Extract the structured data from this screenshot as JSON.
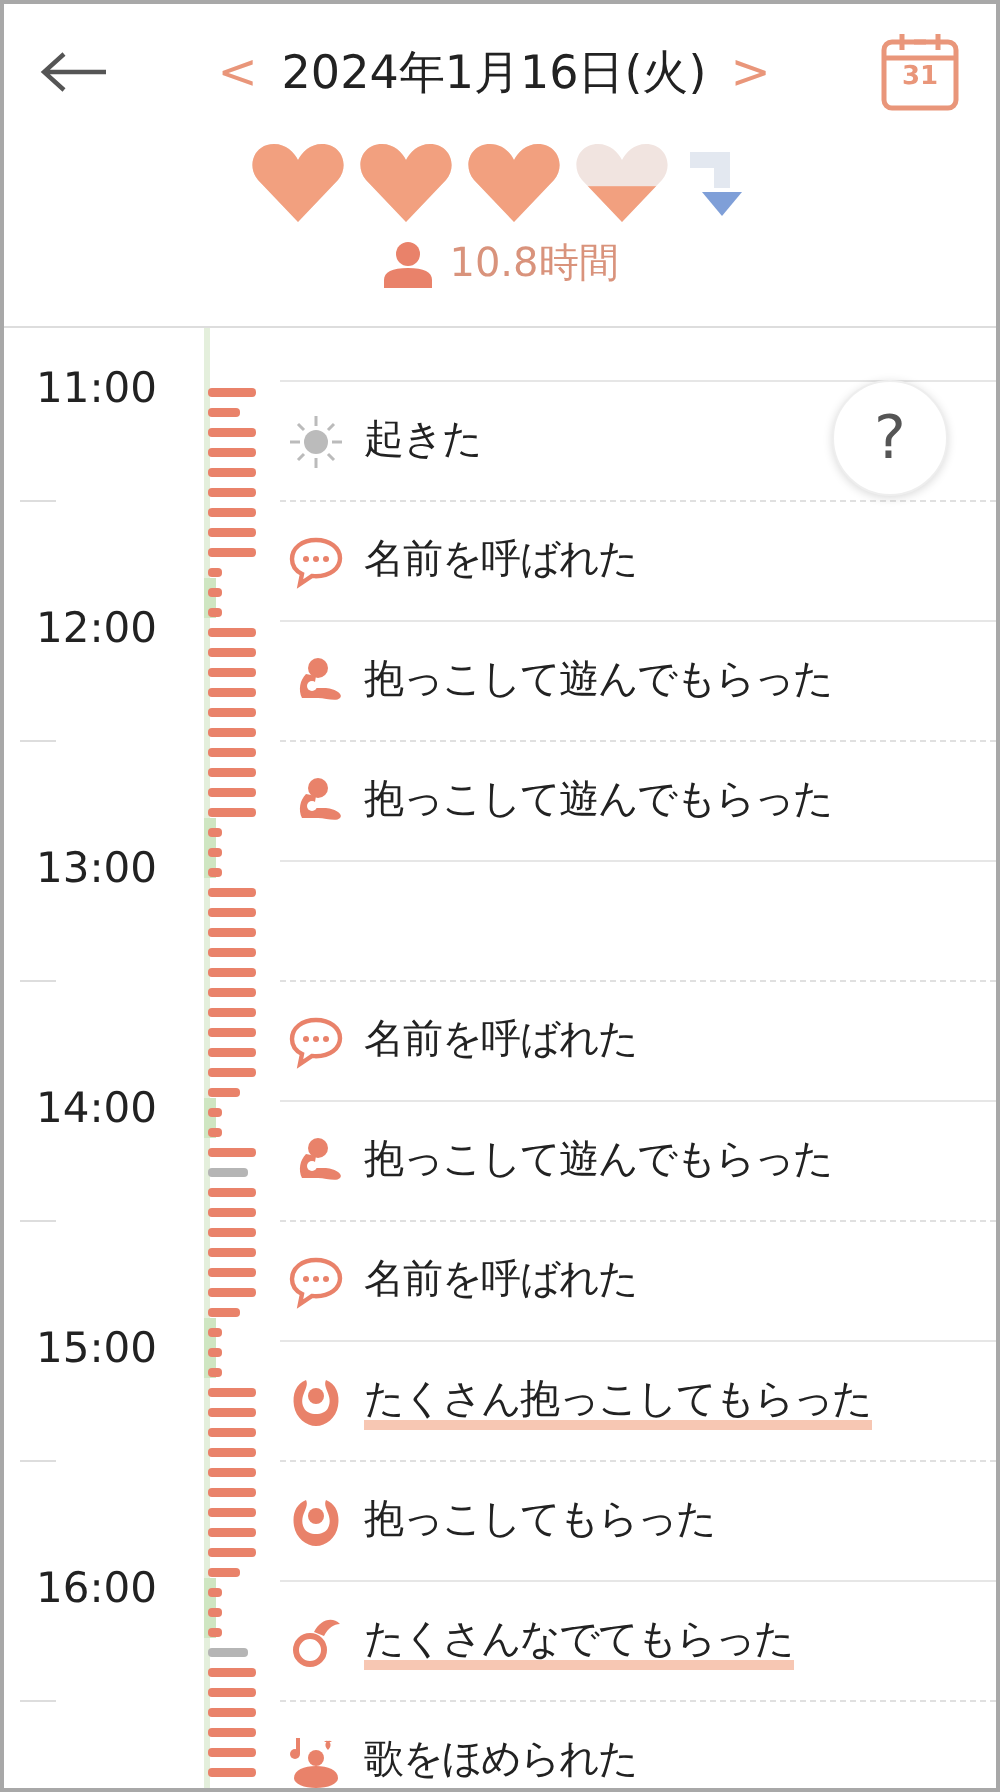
{
  "header": {
    "date": "2024年1月16日(火)",
    "prev_label": "<",
    "next_label": ">",
    "calendar_day": "31"
  },
  "hearts": [
    {
      "kind": "full"
    },
    {
      "kind": "full"
    },
    {
      "kind": "full"
    },
    {
      "kind": "half"
    }
  ],
  "summary": {
    "duration": "10.8時間"
  },
  "hours": [
    "11:00",
    "12:00",
    "13:00",
    "14:00",
    "15:00",
    "16:00"
  ],
  "help_label": "?",
  "events": [
    {
      "kind": "wake",
      "label": "起きた",
      "emphasis": false
    },
    {
      "kind": "called",
      "label": "名前を呼ばれた",
      "emphasis": false
    },
    {
      "kind": "hold_play",
      "label": "抱っこして遊んでもらった",
      "emphasis": false
    },
    {
      "kind": "hold_play",
      "label": "抱っこして遊んでもらった",
      "emphasis": false
    },
    {
      "kind": "gap"
    },
    {
      "kind": "called",
      "label": "名前を呼ばれた",
      "emphasis": false
    },
    {
      "kind": "hold_play",
      "label": "抱っこして遊んでもらった",
      "emphasis": false
    },
    {
      "kind": "called",
      "label": "名前を呼ばれた",
      "emphasis": false
    },
    {
      "kind": "hug",
      "label": "たくさん抱っこしてもらった",
      "emphasis": true
    },
    {
      "kind": "hug",
      "label": "抱っこしてもらった",
      "emphasis": false
    },
    {
      "kind": "stroke",
      "label": "たくさんなでてもらった",
      "emphasis": true
    },
    {
      "kind": "song",
      "label": "歌をほめられた",
      "emphasis": false
    }
  ]
}
